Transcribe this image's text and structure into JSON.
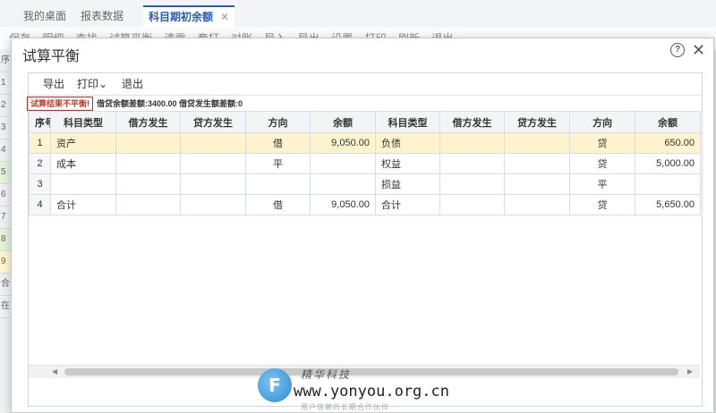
{
  "app": {
    "tabs": [
      {
        "label": "我的桌面"
      },
      {
        "label": "报表数据"
      },
      {
        "label": "科目期初余额",
        "close": "✕"
      }
    ],
    "toolbar_partial": [
      "保存",
      "明细",
      "查找",
      "试算平衡",
      "清零",
      "套打",
      "对账",
      "导入",
      "导出",
      "设置",
      "打印",
      "刷新",
      "退出"
    ],
    "left_labels": [
      "序",
      "1",
      "2",
      "3",
      "4",
      "5",
      "6",
      "7",
      "8",
      "9",
      "合",
      "在"
    ]
  },
  "dialog": {
    "title": "试算平衡",
    "help_icon": "?",
    "close_icon": "✕",
    "menu": {
      "export": "导出",
      "print": "打印",
      "print_caret": "⌄",
      "quit": "退出"
    },
    "status_warning": "试算结果不平衡!",
    "status_text": "借贷余额差额:3400.00 借贷发生额差额:0",
    "columns": [
      "序号",
      "科目类型",
      "借方发生",
      "贷方发生",
      "方向",
      "余额",
      "科目类型",
      "借方发生",
      "贷方发生",
      "方向",
      "余额"
    ],
    "rows": [
      {
        "no": "1",
        "type_l": "资产",
        "debit_l": "",
        "credit_l": "",
        "dir_l": "借",
        "bal_l": "9,050.00",
        "type_r": "负债",
        "debit_r": "",
        "credit_r": "",
        "dir_r": "贷",
        "bal_r": "650.00"
      },
      {
        "no": "2",
        "type_l": "成本",
        "debit_l": "",
        "credit_l": "",
        "dir_l": "平",
        "bal_l": "",
        "type_r": "权益",
        "debit_r": "",
        "credit_r": "",
        "dir_r": "贷",
        "bal_r": "5,000.00"
      },
      {
        "no": "3",
        "type_l": "",
        "debit_l": "",
        "credit_l": "",
        "dir_l": "",
        "bal_l": "",
        "type_r": "损益",
        "debit_r": "",
        "credit_r": "",
        "dir_r": "平",
        "bal_r": ""
      },
      {
        "no": "4",
        "type_l": "合计",
        "debit_l": "",
        "credit_l": "",
        "dir_l": "借",
        "bal_l": "9,050.00",
        "type_r": "合计",
        "debit_r": "",
        "credit_r": "",
        "dir_r": "贷",
        "bal_r": "5,650.00"
      }
    ],
    "selected_row": 0
  },
  "watermark": {
    "logo": "F",
    "script": "精华科技",
    "url": "www.yonyou.org.cn",
    "sub": "用户信赖的长期合作伙伴"
  },
  "colors": {
    "accent": "#2a5db0",
    "warning_text": "#c0392b",
    "warning_border": "#dd2222",
    "selected_row_bg": "#fdf3cc"
  }
}
